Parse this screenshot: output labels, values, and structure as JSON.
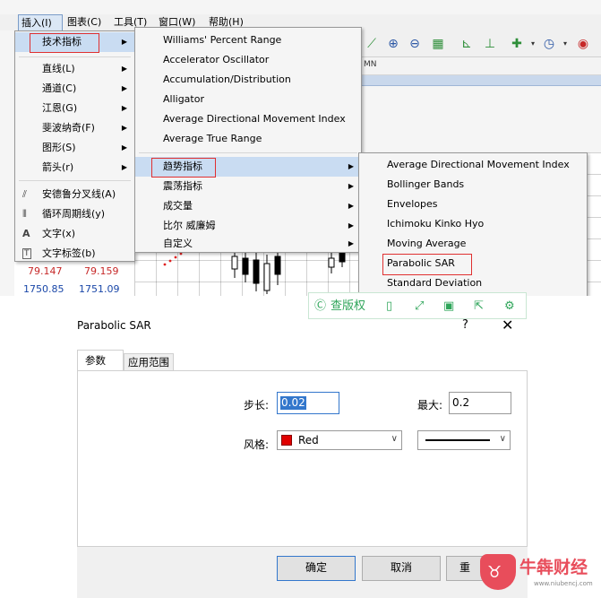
{
  "menubar": {
    "items": [
      "插入(I)",
      "图表(C)",
      "工具(T)",
      "窗口(W)",
      "帮助(H)"
    ]
  },
  "insert_menu": {
    "items": [
      {
        "label": "技术指标",
        "has_submenu": true
      },
      {
        "label": "直线(L)",
        "has_submenu": true
      },
      {
        "label": "通道(C)",
        "has_submenu": true
      },
      {
        "label": "江恩(G)",
        "has_submenu": true
      },
      {
        "label": "斐波纳奇(F)",
        "has_submenu": true
      },
      {
        "label": "图形(S)",
        "has_submenu": true
      },
      {
        "label": "箭头(r)",
        "has_submenu": true
      },
      {
        "label": "安德鲁分叉线(A)",
        "icon": "pitchfork-icon"
      },
      {
        "label": "循环周期线(y)",
        "icon": "cycle-lines-icon"
      },
      {
        "label": "文字(x)",
        "icon": "text-icon",
        "glyph": "A"
      },
      {
        "label": "文字标签(b)",
        "icon": "text-label-icon",
        "glyph": "T"
      }
    ]
  },
  "indicators_menu": {
    "items": [
      "Williams' Percent Range",
      "Accelerator Oscillator",
      "Accumulation/Distribution",
      "Alligator",
      "Average Directional Movement Index",
      "Average True Range"
    ],
    "groups": [
      "趋势指标",
      "震荡指标",
      "成交量",
      "比尔 威廉姆",
      "自定义"
    ]
  },
  "trend_menu": {
    "items": [
      "Average Directional Movement Index",
      "Bollinger Bands",
      "Envelopes",
      "Ichimoku Kinko Hyo",
      "Moving Average",
      "Parabolic SAR",
      "Standard Deviation"
    ]
  },
  "timeframe": {
    "label": "MN"
  },
  "quotes": {
    "bid1": "79.147",
    "ask1": "79.159",
    "bid2": "1750.85",
    "ask2": "1751.09"
  },
  "watermark_bar": {
    "label": "查版权"
  },
  "dialog": {
    "title": "Parabolic SAR",
    "help": "?",
    "close": "✕",
    "tabs": [
      "参数",
      "应用范围"
    ],
    "step_label": "步长:",
    "step_value": "0.02",
    "max_label": "最大:",
    "max_value": "0.2",
    "style_label": "风格:",
    "color_name": "Red",
    "ok": "确定",
    "cancel": "取消",
    "third": "重"
  },
  "colors": {
    "accent": "#3377cc",
    "highlight": "#c9dcf2",
    "red": "#e00000",
    "brand": "#e84d5b",
    "watermark": "#2fa55a"
  },
  "brand": {
    "name": "牛犇财经",
    "url": "www.niubencj.com"
  }
}
